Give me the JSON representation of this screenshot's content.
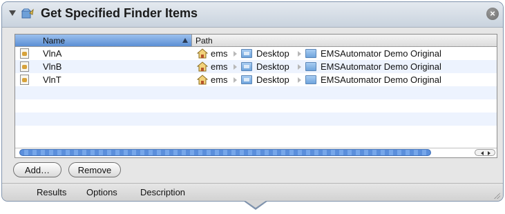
{
  "action": {
    "title": "Get Specified Finder Items",
    "disclosure_icon": "disclosure-triangle-down",
    "action_icon": "finder-action-icon",
    "close_icon": "close-circle-icon",
    "close_glyph": "×"
  },
  "table": {
    "columns": {
      "name": "Name",
      "path": "Path"
    },
    "sorted_column": "Name",
    "sort_direction": "ascending",
    "rows": [
      {
        "name": "VlnA",
        "path": [
          "ems",
          "Desktop",
          "EMSAutomator Demo Original"
        ]
      },
      {
        "name": "VlnB",
        "path": [
          "ems",
          "Desktop",
          "EMSAutomator Demo Original"
        ]
      },
      {
        "name": "VlnT",
        "path": [
          "ems",
          "Desktop",
          "EMSAutomator Demo Original"
        ]
      }
    ]
  },
  "buttons": {
    "add": "Add…",
    "remove": "Remove"
  },
  "tabs": [
    "Results",
    "Options",
    "Description"
  ],
  "colors": {
    "selection_blue": "#5b8fd4",
    "panel_border": "#7f93ad",
    "alt_row": "#edf3fe"
  }
}
